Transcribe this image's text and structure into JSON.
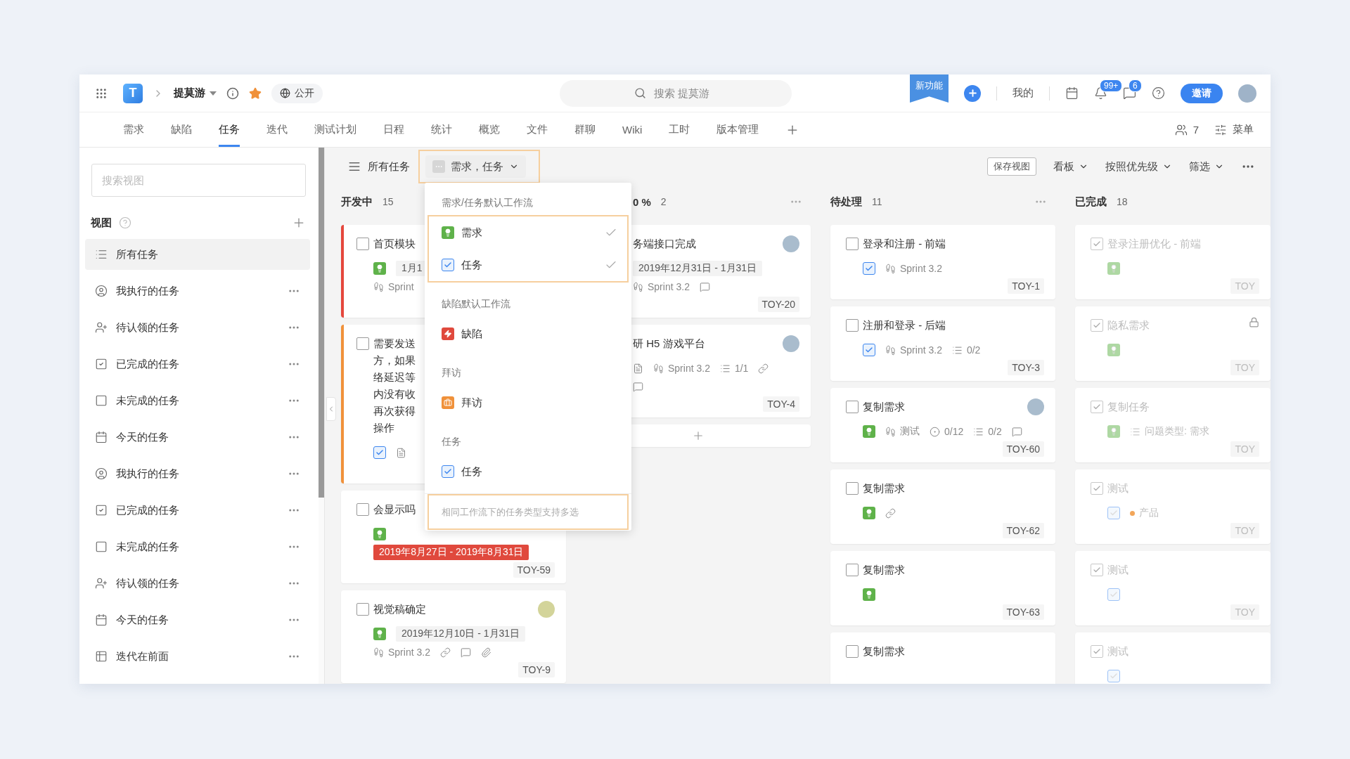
{
  "app": {
    "logo": "T",
    "project": "提莫游",
    "visibility": "公开",
    "search_placeholder": "搜索 提莫游",
    "new_feature": "新功能",
    "mine": "我的",
    "notifications": "99+",
    "messages": "6",
    "invite": "邀请"
  },
  "tabs": [
    {
      "label": "需求",
      "selected": false
    },
    {
      "label": "缺陷",
      "selected": false
    },
    {
      "label": "任务",
      "selected": true
    },
    {
      "label": "迭代",
      "selected": false
    },
    {
      "label": "测试计划",
      "selected": false
    },
    {
      "label": "日程",
      "selected": false
    },
    {
      "label": "统计",
      "selected": false
    },
    {
      "label": "概览",
      "selected": false
    },
    {
      "label": "文件",
      "selected": false
    },
    {
      "label": "群聊",
      "selected": false
    },
    {
      "label": "Wiki",
      "selected": false
    },
    {
      "label": "工时",
      "selected": false
    },
    {
      "label": "版本管理",
      "selected": false
    }
  ],
  "members": "7",
  "menu": "菜单",
  "sidebar": {
    "search_placeholder": "搜索视图",
    "title": "视图",
    "items": [
      {
        "label": "所有任务",
        "kind": "all",
        "selected": true
      },
      {
        "label": "我执行的任务",
        "kind": "mine",
        "selected": false
      },
      {
        "label": "待认领的任务",
        "kind": "unclaimed",
        "selected": false
      },
      {
        "label": "已完成的任务",
        "kind": "done",
        "selected": false
      },
      {
        "label": "未完成的任务",
        "kind": "undone",
        "selected": false
      },
      {
        "label": "今天的任务",
        "kind": "today",
        "selected": false
      },
      {
        "label": "我执行的任务",
        "kind": "mine",
        "selected": false
      },
      {
        "label": "已完成的任务",
        "kind": "done",
        "selected": false
      },
      {
        "label": "未完成的任务",
        "kind": "undone",
        "selected": false
      },
      {
        "label": "待认领的任务",
        "kind": "unclaimed",
        "selected": false
      },
      {
        "label": "今天的任务",
        "kind": "today",
        "selected": false
      },
      {
        "label": "迭代在前面",
        "kind": "iteration",
        "selected": false
      }
    ]
  },
  "toolbar": {
    "view": "所有任务",
    "filter": "需求，任务",
    "filter_highlighted": true,
    "save": "保存视图",
    "layout": "看板",
    "sort": "按照优先级",
    "filter_menu": "筛选"
  },
  "columns": [
    {
      "title": "开发中",
      "count": "15",
      "cards": [
        {
          "title": "首页模块",
          "checked": false,
          "color": "#e5473c",
          "rows": [
            [
              {
                "kind": "requirement"
              },
              {
                "kind": "date",
                "text": "1月1"
              }
            ],
            [
              {
                "kind": "sprint",
                "text": "Sprint"
              }
            ]
          ]
        },
        {
          "title": "需要发送方，如果络延迟等内没有收再次获得操作",
          "checked": false,
          "color": "#f0913a",
          "rows": [
            [
              {
                "kind": "task"
              },
              {
                "kind": "doc"
              }
            ]
          ]
        },
        {
          "title": "会显示吗",
          "checked": false,
          "rows": [
            [
              {
                "kind": "requirement"
              }
            ],
            [
              {
                "kind": "overdue",
                "text": "2019年8月27日 - 2019年8月31日"
              }
            ]
          ],
          "id": "TOY-59"
        },
        {
          "title": "视觉稿确定",
          "checked": false,
          "avatar": {
            "kind": "badge"
          },
          "rows": [
            [
              {
                "kind": "requirement"
              },
              {
                "kind": "date",
                "text": "2019年12月10日 - 1月31日"
              }
            ],
            [
              {
                "kind": "sprint",
                "text": "Sprint 3.2"
              },
              {
                "kind": "link"
              },
              {
                "kind": "comment"
              },
              {
                "kind": "attach"
              }
            ]
          ],
          "id": "TOY-9"
        }
      ]
    },
    {
      "title": "0 %",
      "count": "2",
      "more": true,
      "add": true,
      "cards": [
        {
          "title": "务端接口完成",
          "avatar": {
            "kind": "photo"
          },
          "rows": [
            [
              {
                "kind": "date",
                "text": "2019年12月31日 - 1月31日"
              }
            ],
            [
              {
                "kind": "sprint",
                "text": "Sprint 3.2"
              },
              {
                "kind": "comment"
              }
            ]
          ],
          "id": "TOY-20"
        },
        {
          "title": "研 H5 游戏平台",
          "avatar": {
            "kind": "photo"
          },
          "rows": [
            [
              {
                "kind": "doc"
              },
              {
                "kind": "sprint",
                "text": "Sprint 3.2"
              },
              {
                "kind": "subtasks",
                "text": "1/1"
              },
              {
                "kind": "link"
              }
            ],
            [
              {
                "kind": "comment"
              }
            ]
          ],
          "id": "TOY-4"
        }
      ]
    },
    {
      "title": "待处理",
      "count": "11",
      "more": true,
      "cards": [
        {
          "title": "登录和注册 - 前端",
          "checked": false,
          "rows": [
            [
              {
                "kind": "task"
              },
              {
                "kind": "sprint",
                "text": "Sprint 3.2"
              }
            ]
          ],
          "id": "TOY-1"
        },
        {
          "title": "注册和登录 - 后端",
          "checked": false,
          "rows": [
            [
              {
                "kind": "task"
              },
              {
                "kind": "sprint",
                "text": "Sprint 3.2"
              },
              {
                "kind": "subtasks",
                "text": "0/2"
              }
            ]
          ],
          "id": "TOY-3"
        },
        {
          "title": "复制需求",
          "checked": false,
          "avatar": {
            "kind": "photo"
          },
          "rows": [
            [
              {
                "kind": "requirement"
              },
              {
                "kind": "sprint",
                "text": "测试"
              },
              {
                "kind": "progress",
                "text": "0/12"
              },
              {
                "kind": "subtasks",
                "text": "0/2"
              },
              {
                "kind": "comment"
              }
            ]
          ],
          "id": "TOY-60"
        },
        {
          "title": "复制需求",
          "checked": false,
          "rows": [
            [
              {
                "kind": "requirement"
              },
              {
                "kind": "link"
              }
            ]
          ],
          "id": "TOY-62"
        },
        {
          "title": "复制需求",
          "checked": false,
          "rows": [
            [
              {
                "kind": "requirement"
              }
            ]
          ],
          "id": "TOY-63"
        },
        {
          "title": "复制需求",
          "checked": false
        }
      ]
    },
    {
      "title": "已完成",
      "count": "18",
      "cards": [
        {
          "title": "登录注册优化 - 前端",
          "checked": true,
          "rows": [
            [
              {
                "kind": "requirement"
              }
            ]
          ],
          "id": "TOY"
        },
        {
          "title": "隐私需求",
          "checked": true,
          "locked": true,
          "rows": [
            [
              {
                "kind": "requirement"
              }
            ]
          ],
          "id": "TOY"
        },
        {
          "title": "复制任务",
          "checked": true,
          "rows": [
            [
              {
                "kind": "requirement"
              },
              {
                "kind": "issue",
                "text": "问题类型: 需求"
              }
            ]
          ],
          "id": "TOY"
        },
        {
          "title": "测试",
          "checked": true,
          "rows": [
            [
              {
                "kind": "task"
              },
              {
                "kind": "tag",
                "text": "产品",
                "color": "#f2a65a"
              }
            ]
          ],
          "id": "TOY"
        },
        {
          "title": "测试",
          "checked": true,
          "rows": [
            [
              {
                "kind": "task"
              }
            ]
          ],
          "id": "TOY"
        },
        {
          "title": "测试",
          "checked": true,
          "rows": [
            [
              {
                "kind": "task"
              }
            ]
          ]
        }
      ]
    }
  ],
  "type_menu": {
    "groups": [
      {
        "title": "需求/任务默认工作流",
        "highlighted": true,
        "options": [
          {
            "label": "需求",
            "kind": "requirement",
            "selected": true
          },
          {
            "label": "任务",
            "kind": "task",
            "selected": true
          }
        ]
      },
      {
        "title": "缺陷默认工作流",
        "highlighted": false,
        "options": [
          {
            "label": "缺陷",
            "kind": "bug",
            "selected": false
          }
        ]
      },
      {
        "title": "拜访",
        "highlighted": false,
        "options": [
          {
            "label": "拜访",
            "kind": "visit",
            "selected": false
          }
        ]
      },
      {
        "title": "任务",
        "highlighted": false,
        "options": [
          {
            "label": "任务",
            "kind": "task",
            "selected": false
          }
        ]
      }
    ],
    "hint": "相同工作流下的任务类型支持多选",
    "hint_highlighted": true
  }
}
